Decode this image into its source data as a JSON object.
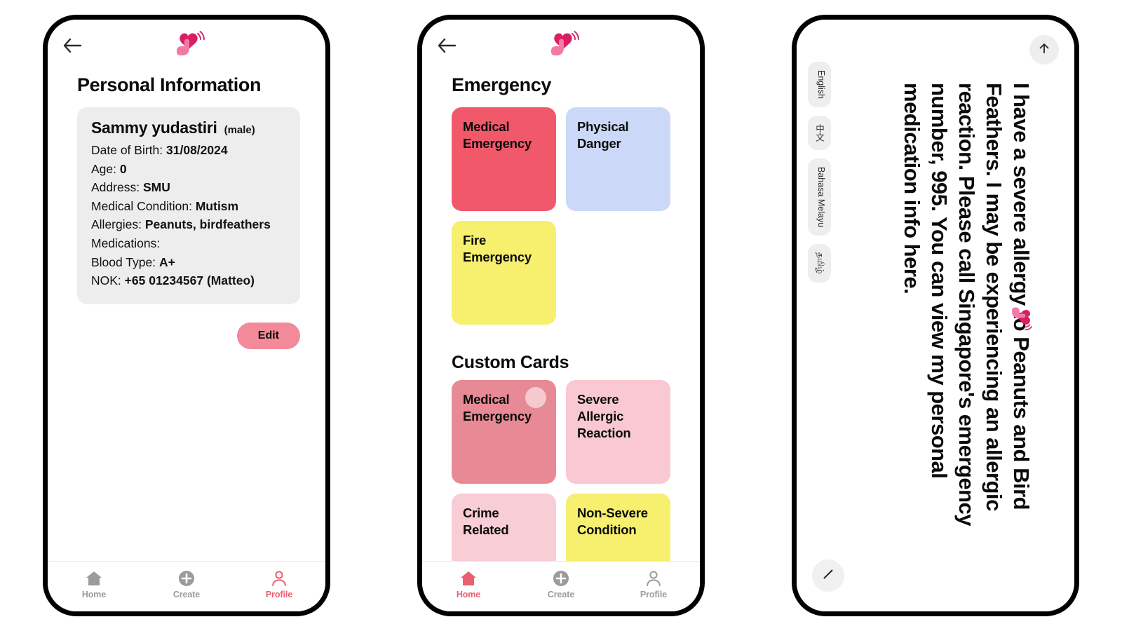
{
  "app": {
    "logo_icon": "heart-hand-logo",
    "back_icon": "back-arrow-icon"
  },
  "phone1": {
    "page_title": "Personal Information",
    "profile": {
      "name": "Sammy yudastiri",
      "gender": "(male)",
      "fields": [
        {
          "label": "Date of Birth:",
          "value": "31/08/2024"
        },
        {
          "label": "Age:",
          "value": "0"
        },
        {
          "label": "Address:",
          "value": "SMU"
        },
        {
          "label": "Medical Condition:",
          "value": "Mutism"
        },
        {
          "label": "Allergies:",
          "value": "Peanuts, birdfeathers"
        },
        {
          "label": "Medications:",
          "value": ""
        },
        {
          "label": "Blood Type:",
          "value": "A+"
        },
        {
          "label": "NOK:",
          "value": "+65 01234567 (Matteo)"
        }
      ]
    },
    "edit_label": "Edit",
    "nav": [
      {
        "label": "Home",
        "icon": "home-icon",
        "active": false
      },
      {
        "label": "Create",
        "icon": "plus-circle-icon",
        "active": false
      },
      {
        "label": "Profile",
        "icon": "person-icon",
        "active": true
      }
    ]
  },
  "phone2": {
    "page_title": "Emergency",
    "emergency_cards": [
      {
        "label": "Medical Emergency",
        "color": "#f1596b"
      },
      {
        "label": "Physical Danger",
        "color": "#ccd8f7"
      },
      {
        "label": "Fire Emergency",
        "color": "#f7ef6e"
      }
    ],
    "custom_section_title": "Custom Cards",
    "custom_cards": [
      {
        "label": "Medical Emergency",
        "color": "#e78a95",
        "ripple": true
      },
      {
        "label": "Severe Allergic Reaction",
        "color": "#f9c8d2",
        "ripple": false
      },
      {
        "label": "Crime Related",
        "color": "#f9cdd6",
        "ripple": false
      },
      {
        "label": "Non-Severe Condition",
        "color": "#f7ef6e",
        "ripple": false
      }
    ],
    "nav": [
      {
        "label": "Home",
        "icon": "home-icon",
        "active": true
      },
      {
        "label": "Create",
        "icon": "plus-circle-icon",
        "active": false
      },
      {
        "label": "Profile",
        "icon": "person-icon",
        "active": false
      }
    ]
  },
  "phone3": {
    "message": "I have a severe allergy to Peanuts and Bird Feathers. I may be experiencing an allergic reaction. Please call Singapore's emergency number, 995. You can view my personal medication info here.",
    "languages": [
      "English",
      "中文",
      "Bahasa Melayu",
      "தமிழ்"
    ],
    "top_button_icon": "arrow-up-icon",
    "bottom_button_icon": "diagonal-line-icon",
    "logo_icon": "heart-hand-logo"
  },
  "colors": {
    "accent": "#ea5f70",
    "edit_button": "#f28a99",
    "card_gray": "#ededed",
    "nav_inactive": "#9b9b9b"
  }
}
